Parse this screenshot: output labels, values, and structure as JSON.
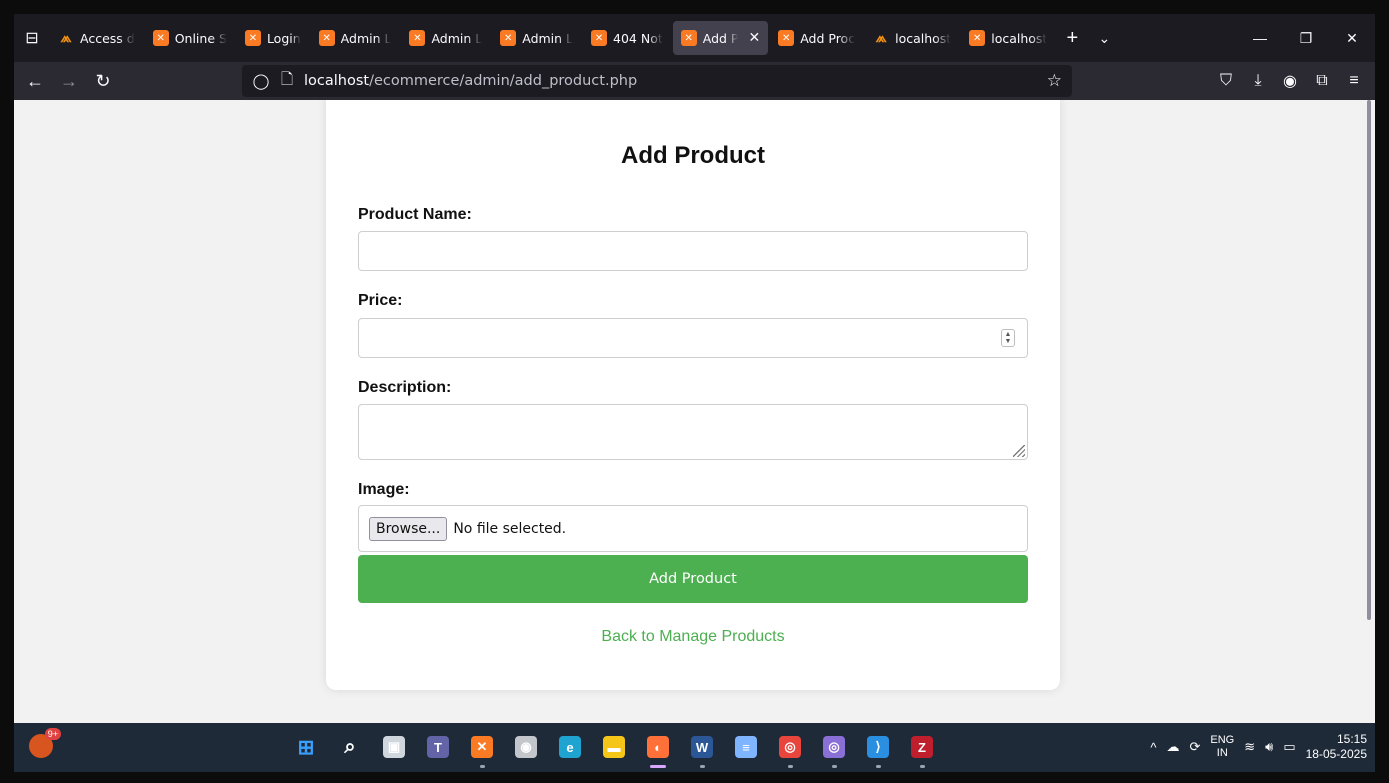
{
  "browser": {
    "tabs": [
      {
        "label": "Access d",
        "icon": "phpmyadmin-icon",
        "active": false
      },
      {
        "label": "Online S",
        "icon": "xampp-icon",
        "active": false
      },
      {
        "label": "Login",
        "icon": "xampp-icon",
        "active": false
      },
      {
        "label": "Admin L",
        "icon": "xampp-icon",
        "active": false
      },
      {
        "label": "Admin L",
        "icon": "xampp-icon",
        "active": false
      },
      {
        "label": "Admin L",
        "icon": "xampp-icon",
        "active": false
      },
      {
        "label": "404 Not",
        "icon": "xampp-icon",
        "active": false
      },
      {
        "label": "Add P",
        "icon": "xampp-icon",
        "active": true
      },
      {
        "label": "Add Proc",
        "icon": "xampp-icon",
        "active": false
      },
      {
        "label": "localhost",
        "icon": "phpmyadmin-icon",
        "active": false
      },
      {
        "label": "localhost",
        "icon": "xampp-icon",
        "active": false
      }
    ],
    "url_host": "localhost",
    "url_path": "/ecommerce/admin/add_product.php"
  },
  "form": {
    "title": "Add Product",
    "name_label": "Product Name:",
    "name_value": "",
    "price_label": "Price:",
    "price_value": "",
    "description_label": "Description:",
    "description_value": "",
    "image_label": "Image:",
    "browse_label": "Browse...",
    "file_status": "No file selected.",
    "submit_label": "Add Product",
    "back_link": "Back to Manage Products"
  },
  "taskbar": {
    "weather_badge": "9+",
    "apps": [
      {
        "name": "start-icon",
        "color": "#3aa0ff"
      },
      {
        "name": "search-icon",
        "color": "#ffffff"
      },
      {
        "name": "task-view-icon",
        "color": "#cfd6de"
      },
      {
        "name": "teams-icon",
        "color": "#6264a7"
      },
      {
        "name": "xampp-icon",
        "color": "#fb7a24"
      },
      {
        "name": "camera-icon",
        "color": "#c3c7cc"
      },
      {
        "name": "edge-icon",
        "color": "#1fa3d1"
      },
      {
        "name": "file-explorer-icon",
        "color": "#f5c518"
      },
      {
        "name": "firefox-icon",
        "color": "#ff7139"
      },
      {
        "name": "word-icon",
        "color": "#2b5797"
      },
      {
        "name": "notepad-icon",
        "color": "#7fb5ff"
      },
      {
        "name": "chrome-icon",
        "color": "#e8453c"
      },
      {
        "name": "chrome-profile-icon",
        "color": "#8a6fd6"
      },
      {
        "name": "vscode-icon",
        "color": "#2a8fe0"
      },
      {
        "name": "filezilla-icon",
        "color": "#bf1e2d"
      }
    ],
    "lang_top": "ENG",
    "lang_bottom": "IN",
    "time": "15:15",
    "date": "18-05-2025"
  }
}
